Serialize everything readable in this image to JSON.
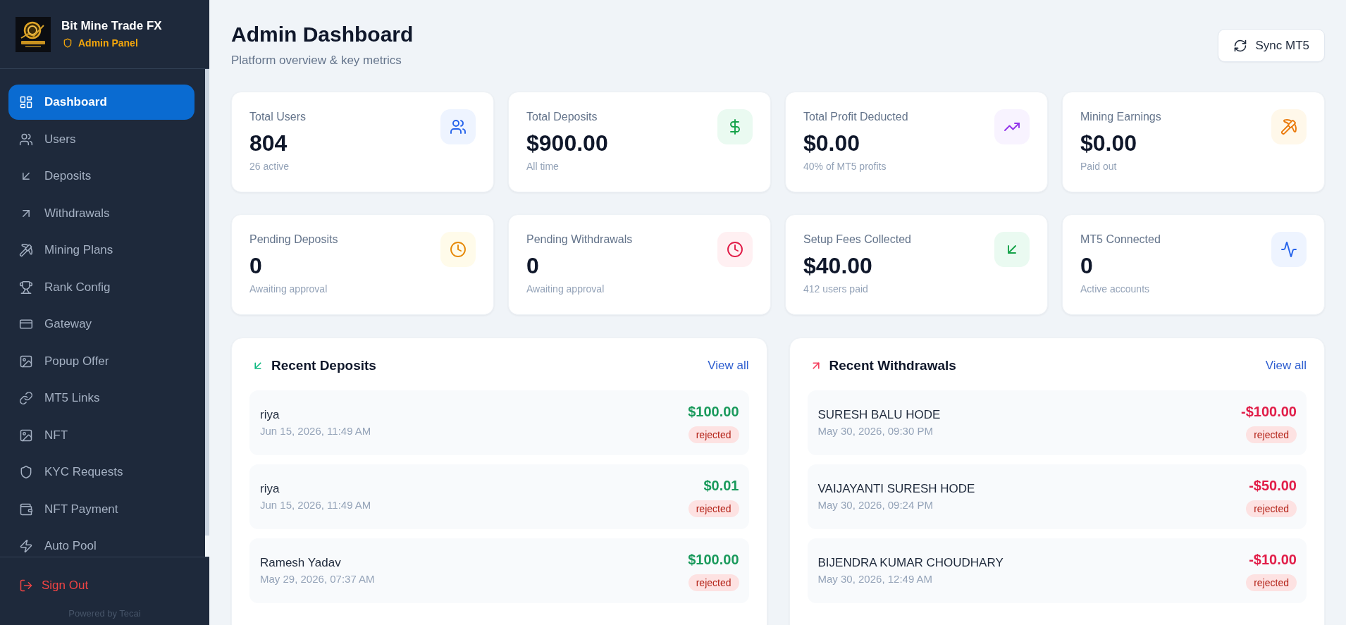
{
  "sidebar": {
    "brand": {
      "title": "Bit Mine Trade FX",
      "subtitle": "Admin Panel"
    },
    "items": [
      {
        "label": "Dashboard",
        "selected": true
      },
      {
        "label": "Users",
        "selected": false
      },
      {
        "label": "Deposits",
        "selected": false
      },
      {
        "label": "Withdrawals",
        "selected": false
      },
      {
        "label": "Mining Plans",
        "selected": false
      },
      {
        "label": "Rank Config",
        "selected": false
      },
      {
        "label": "Gateway",
        "selected": false
      },
      {
        "label": "Popup Offer",
        "selected": false
      },
      {
        "label": "MT5 Links",
        "selected": false
      },
      {
        "label": "NFT",
        "selected": false
      },
      {
        "label": "KYC Requests",
        "selected": false
      },
      {
        "label": "NFT Payment",
        "selected": false
      },
      {
        "label": "Auto Pool",
        "selected": false
      }
    ],
    "sign_out": "Sign Out",
    "footer": "Powered by Tecai"
  },
  "header": {
    "title": "Admin Dashboard",
    "subtitle": "Platform overview & key metrics",
    "button": "Sync MT5"
  },
  "stats": [
    {
      "label": "Total Users",
      "value": "804",
      "note": "26 active"
    },
    {
      "label": "Total Deposits",
      "value": "$900.00",
      "note": "All time"
    },
    {
      "label": "Total Profit Deducted",
      "value": "$0.00",
      "note": "40% of MT5 profits"
    },
    {
      "label": "Mining Earnings",
      "value": "$0.00",
      "note": "Paid out"
    },
    {
      "label": "Pending Deposits",
      "value": "0",
      "note": "Awaiting approval"
    },
    {
      "label": "Pending Withdrawals",
      "value": "0",
      "note": "Awaiting approval"
    },
    {
      "label": "Setup Fees Collected",
      "value": "$40.00",
      "note": "412 users paid"
    },
    {
      "label": "MT5 Connected",
      "value": "0",
      "note": "Active accounts"
    }
  ],
  "panels": [
    {
      "kind": "deposit",
      "title": "Recent Deposits",
      "link": "View all",
      "rows": [
        {
          "name": "riya",
          "date": "Jun 15, 2026, 11:49 AM",
          "amount": "$100.00",
          "status": "rejected"
        },
        {
          "name": "riya",
          "date": "Jun 15, 2026, 11:49 AM",
          "amount": "$0.01",
          "status": "rejected"
        },
        {
          "name": "Ramesh Yadav",
          "date": "May 29, 2026, 07:37 AM",
          "amount": "$100.00",
          "status": "rejected"
        }
      ]
    },
    {
      "kind": "withdrawal",
      "title": "Recent Withdrawals",
      "link": "View all",
      "rows": [
        {
          "name": "SURESH BALU HODE",
          "date": "May 30, 2026, 09:30 PM",
          "amount": "-$100.00",
          "status": "rejected"
        },
        {
          "name": "VAIJAYANTI SURESH HODE",
          "date": "May 30, 2026, 09:24 PM",
          "amount": "-$50.00",
          "status": "rejected"
        },
        {
          "name": "BIJENDRA KUMAR CHOUDHARY",
          "date": "May 30, 2026, 12:49 AM",
          "amount": "-$10.00",
          "status": "rejected"
        }
      ]
    }
  ]
}
